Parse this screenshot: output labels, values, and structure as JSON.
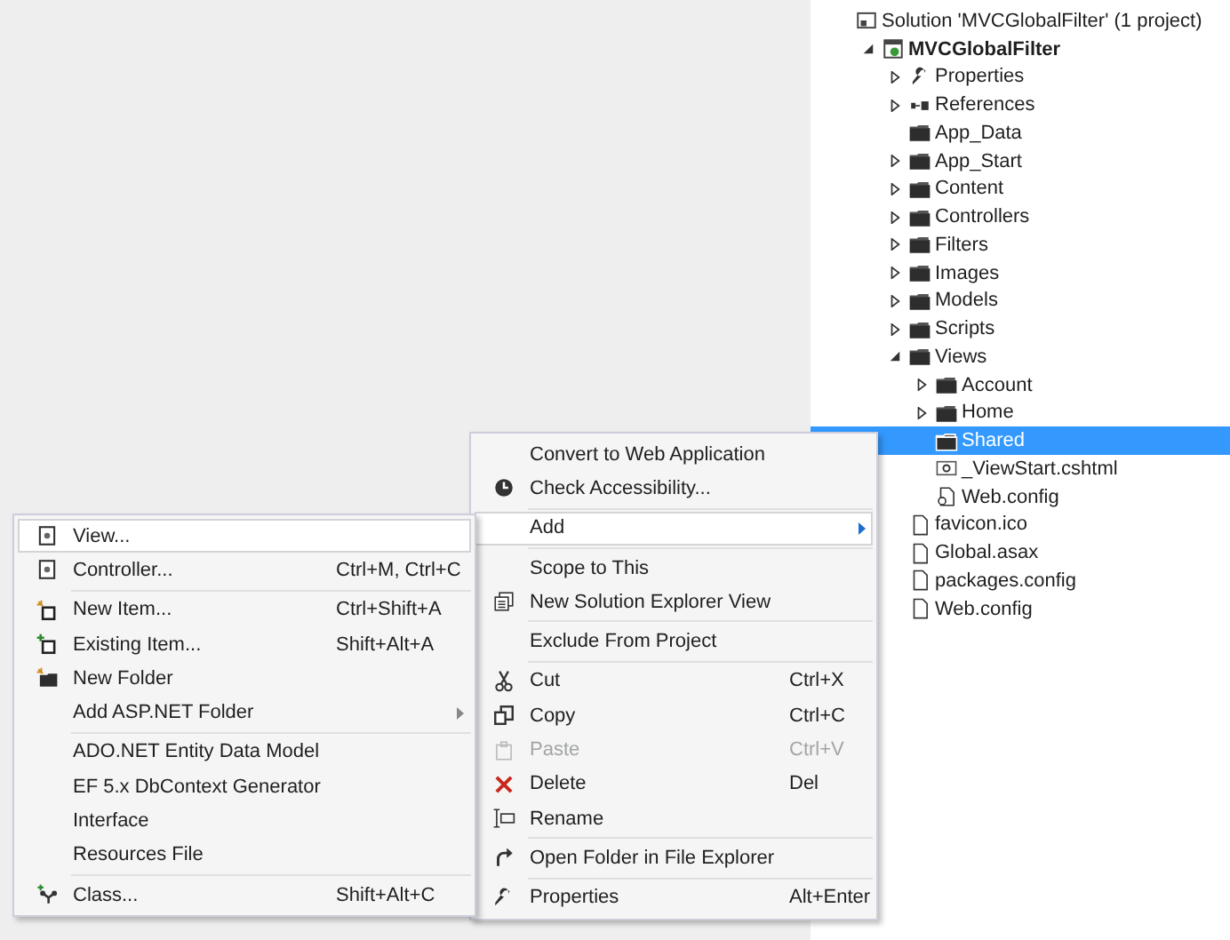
{
  "solution_explorer": {
    "tree": [
      {
        "label": "Solution 'MVCGlobalFilter' (1 project)",
        "kind": "solution",
        "selected": false,
        "children": [
          {
            "label": "MVCGlobalFilter",
            "kind": "project",
            "expanded": true,
            "selected": false,
            "children": [
              {
                "label": "Properties",
                "kind": "properties",
                "expanded": false,
                "selected": false
              },
              {
                "label": "References",
                "kind": "references",
                "expanded": false,
                "selected": false
              },
              {
                "label": "App_Data",
                "kind": "folder",
                "selected": false
              },
              {
                "label": "App_Start",
                "kind": "folder",
                "expanded": false,
                "selected": false
              },
              {
                "label": "Content",
                "kind": "folder",
                "expanded": false,
                "selected": false
              },
              {
                "label": "Controllers",
                "kind": "folder",
                "expanded": false,
                "selected": false
              },
              {
                "label": "Filters",
                "kind": "folder",
                "expanded": false,
                "selected": false
              },
              {
                "label": "Images",
                "kind": "folder",
                "expanded": false,
                "selected": false
              },
              {
                "label": "Models",
                "kind": "folder",
                "expanded": false,
                "selected": false
              },
              {
                "label": "Scripts",
                "kind": "folder",
                "expanded": false,
                "selected": false
              },
              {
                "label": "Views",
                "kind": "folder",
                "expanded": true,
                "selected": false,
                "children": [
                  {
                    "label": "Account",
                    "kind": "folder",
                    "expanded": false,
                    "selected": false
                  },
                  {
                    "label": "Home",
                    "kind": "folder",
                    "expanded": false,
                    "selected": false
                  },
                  {
                    "label": "Shared",
                    "kind": "folder",
                    "selected": true
                  },
                  {
                    "label": "_ViewStart.cshtml",
                    "kind": "razor",
                    "selected": false
                  },
                  {
                    "label": "Web.config",
                    "kind": "config",
                    "selected": false
                  }
                ]
              },
              {
                "label": "favicon.ico",
                "kind": "file",
                "selected": false
              },
              {
                "label": "Global.asax",
                "kind": "file",
                "selected": false
              },
              {
                "label": "packages.config",
                "kind": "file",
                "selected": false
              },
              {
                "label": "Web.config",
                "kind": "file",
                "selected": false
              }
            ]
          }
        ]
      }
    ]
  },
  "context_menu": {
    "items": [
      {
        "kind": "plain",
        "label": "Convert to Web Application",
        "selected": false
      },
      {
        "kind": "accessibility",
        "label": "Check Accessibility...",
        "selected": false
      },
      {
        "kind": "separator"
      },
      {
        "kind": "plain",
        "label": "Add",
        "submenu": true,
        "selected": true
      },
      {
        "kind": "separator"
      },
      {
        "kind": "plain",
        "label": "Scope to This",
        "selected": false
      },
      {
        "kind": "windows",
        "label": "New Solution Explorer View",
        "selected": false
      },
      {
        "kind": "separator"
      },
      {
        "kind": "plain",
        "label": "Exclude From Project",
        "selected": false
      },
      {
        "kind": "separator"
      },
      {
        "kind": "scissors",
        "label": "Cut",
        "shortcut": "Ctrl+X",
        "selected": false
      },
      {
        "kind": "copy",
        "label": "Copy",
        "shortcut": "Ctrl+C",
        "selected": false
      },
      {
        "kind": "paste",
        "label": "Paste",
        "shortcut": "Ctrl+V",
        "disabled": true,
        "selected": false
      },
      {
        "kind": "cross",
        "label": "Delete",
        "shortcut": "Del",
        "selected": false
      },
      {
        "kind": "rename",
        "label": "Rename",
        "selected": false
      },
      {
        "kind": "separator"
      },
      {
        "kind": "redo",
        "label": "Open Folder in File Explorer",
        "selected": false
      },
      {
        "kind": "separator"
      },
      {
        "kind": "wrench",
        "label": "Properties",
        "shortcut": "Alt+Enter",
        "selected": false
      }
    ]
  },
  "add_submenu": {
    "items": [
      {
        "kind": "page",
        "label": "View...",
        "selected": true
      },
      {
        "kind": "page",
        "label": "Controller...",
        "shortcut": "Ctrl+M, Ctrl+C",
        "selected": false
      },
      {
        "kind": "separator"
      },
      {
        "kind": "new-item",
        "label": "New Item...",
        "shortcut": "Ctrl+Shift+A",
        "selected": false
      },
      {
        "kind": "existing-item",
        "label": "Existing Item...",
        "shortcut": "Shift+Alt+A",
        "selected": false
      },
      {
        "kind": "new-folder",
        "label": "New Folder",
        "selected": false
      },
      {
        "kind": "plain",
        "label": "Add ASP.NET Folder",
        "submenu": true,
        "selected": false
      },
      {
        "kind": "separator"
      },
      {
        "kind": "plain",
        "label": "ADO.NET Entity Data Model",
        "selected": false
      },
      {
        "kind": "plain",
        "label": "EF 5.x DbContext Generator",
        "selected": false
      },
      {
        "kind": "plain",
        "label": "Interface",
        "selected": false
      },
      {
        "kind": "plain",
        "label": "Resources File",
        "selected": false
      },
      {
        "kind": "separator"
      },
      {
        "kind": "class",
        "label": "Class...",
        "shortcut": "Shift+Alt+C",
        "selected": false
      }
    ]
  }
}
